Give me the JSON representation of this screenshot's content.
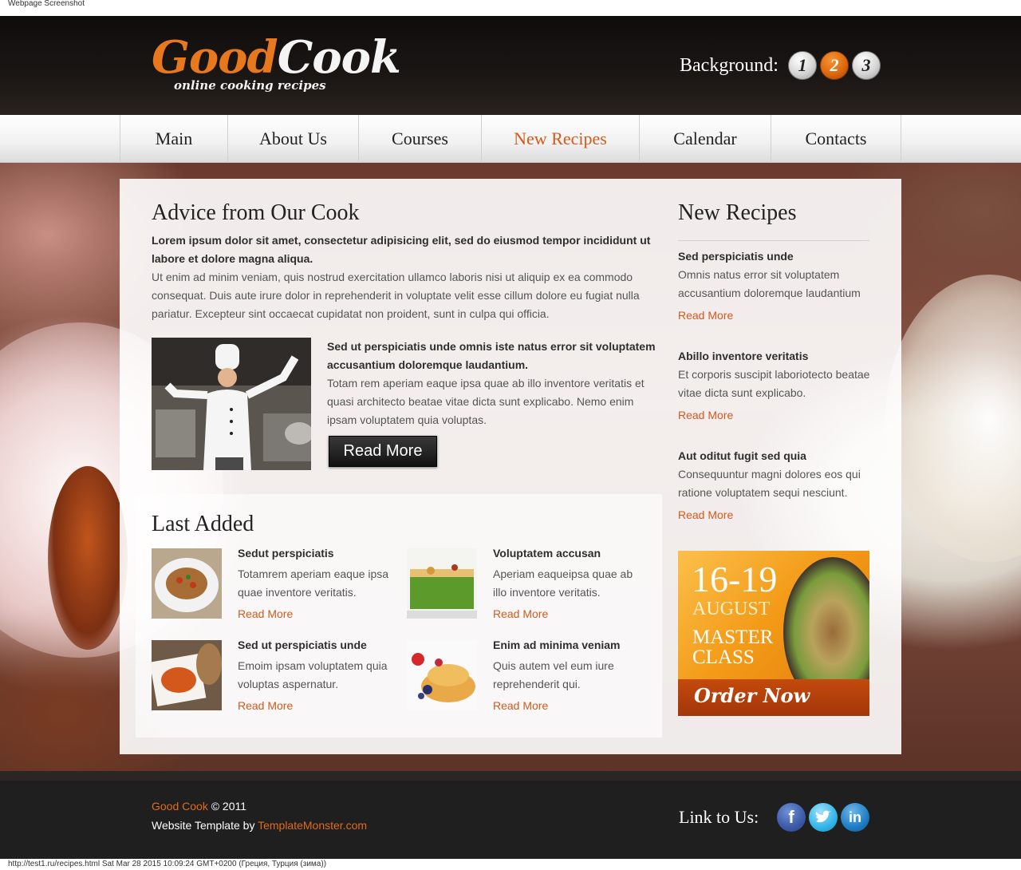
{
  "screenshot_caption": "Webpage Screenshot",
  "header": {
    "logo_good": "Good",
    "logo_cook": "Cook",
    "logo_tagline": "online cooking recipes",
    "background_label": "Background:",
    "background_options": [
      "1",
      "2",
      "3"
    ],
    "background_selected": "2"
  },
  "nav": {
    "items": [
      {
        "label": "Main"
      },
      {
        "label": "About Us"
      },
      {
        "label": "Courses"
      },
      {
        "label": "New Recipes"
      },
      {
        "label": "Calendar"
      },
      {
        "label": "Contacts"
      }
    ],
    "active": "New Recipes"
  },
  "advice": {
    "title": "Advice from Our Cook",
    "lead": "Lorem ipsum dolor sit amet, consectetur adipisicing elit, sed do eiusmod tempor incididunt ut labore et dolore magna aliqua.",
    "body": "Ut enim ad minim veniam, quis nostrud exercitation ullamco laboris nisi ut aliquip ex ea commodo consequat. Duis aute irure dolor in reprehenderit in voluptate velit esse cillum dolore eu fugiat nulla pariatur. Excepteur sint occaecat cupidatat non proident, sunt in culpa qui officia.",
    "feature_lead": "Sed ut perspiciatis unde omnis iste natus error sit voluptatem accusantium doloremque laudantium.",
    "feature_body": "Totam rem aperiam eaque ipsa quae ab illo inventore veritatis et quasi architecto beatae vitae dicta sunt explicabo. Nemo enim ipsam voluptatem quia voluptas.",
    "read_more_button": "Read More"
  },
  "last_added": {
    "title": "Last Added",
    "items": [
      {
        "title": "Sedut perspiciatis",
        "text": "Totamrem aperiam eaque ipsa quae inventore veritatis.",
        "link": "Read More"
      },
      {
        "title": "Voluptatem accusan",
        "text": "Aperiam eaqueipsa quae ab illo inventore veritatis.",
        "link": "Read More"
      },
      {
        "title": "Sed ut perspiciatis unde",
        "text": "Emoim ipsam voluptatem quia voluptas aspernatur.",
        "link": "Read More"
      },
      {
        "title": "Enim ad minima veniam",
        "text": "Quis autem vel eum iure reprehenderit qui.",
        "link": "Read More"
      }
    ]
  },
  "new_recipes": {
    "title": "New Recipes",
    "items": [
      {
        "title": "Sed perspiciatis unde",
        "text": "Omnis natus error sit voluptatem accusantium doloremque laudantium",
        "link": "Read More"
      },
      {
        "title": "Abillo inventore veritatis",
        "text": "Et corporis suscipit laborioteсto beatae vitae dicta sunt explicabo.",
        "link": "Read More"
      },
      {
        "title": "Aut oditut fugit sed quia",
        "text": "Consequuntur magni dolores eos qui ratione voluptatem sequi nesciunt.",
        "link": "Read More"
      }
    ]
  },
  "banner": {
    "dates": "16-19",
    "month": "AUGUST",
    "event": "MASTER CLASS",
    "cta": "Order Now"
  },
  "footer": {
    "brand": "Good Cook",
    "copyright": " © 2011",
    "template_prefix": "Website Template by ",
    "template_link": "TemplateMonster.com",
    "link_to_us": "Link to Us:",
    "social": [
      "facebook-icon",
      "twitter-icon",
      "linkedin-icon"
    ]
  },
  "status_bar": "http://test1.ru/recipes.html Sat Mar 28 2015 10:09:24 GMT+0200 (Греция, Турция (зима))",
  "colors": {
    "accent": "#d4591a",
    "header_bg": "#1a1614",
    "footer_bg": "#1f1f1f"
  }
}
